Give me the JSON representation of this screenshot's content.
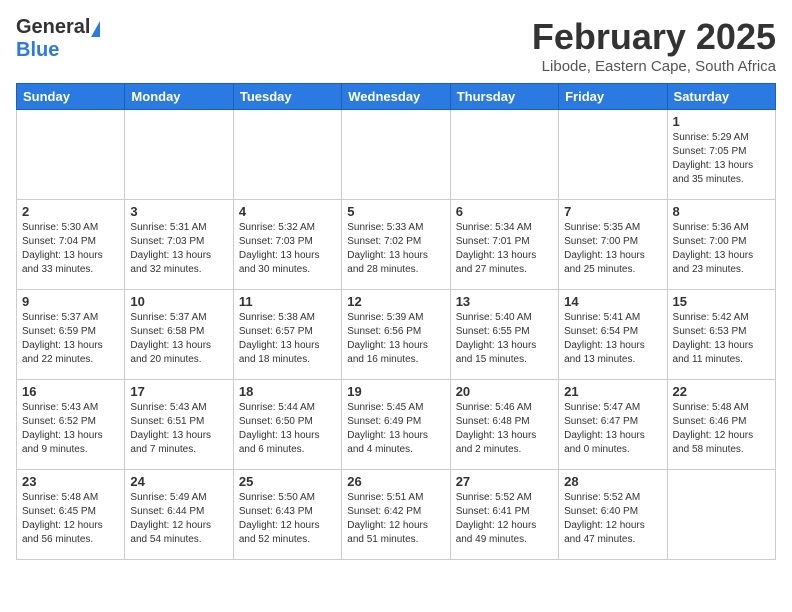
{
  "logo": {
    "general": "General",
    "blue": "Blue"
  },
  "title": "February 2025",
  "subtitle": "Libode, Eastern Cape, South Africa",
  "weekdays": [
    "Sunday",
    "Monday",
    "Tuesday",
    "Wednesday",
    "Thursday",
    "Friday",
    "Saturday"
  ],
  "weeks": [
    [
      {
        "day": "",
        "info": ""
      },
      {
        "day": "",
        "info": ""
      },
      {
        "day": "",
        "info": ""
      },
      {
        "day": "",
        "info": ""
      },
      {
        "day": "",
        "info": ""
      },
      {
        "day": "",
        "info": ""
      },
      {
        "day": "1",
        "info": "Sunrise: 5:29 AM\nSunset: 7:05 PM\nDaylight: 13 hours\nand 35 minutes."
      }
    ],
    [
      {
        "day": "2",
        "info": "Sunrise: 5:30 AM\nSunset: 7:04 PM\nDaylight: 13 hours\nand 33 minutes."
      },
      {
        "day": "3",
        "info": "Sunrise: 5:31 AM\nSunset: 7:03 PM\nDaylight: 13 hours\nand 32 minutes."
      },
      {
        "day": "4",
        "info": "Sunrise: 5:32 AM\nSunset: 7:03 PM\nDaylight: 13 hours\nand 30 minutes."
      },
      {
        "day": "5",
        "info": "Sunrise: 5:33 AM\nSunset: 7:02 PM\nDaylight: 13 hours\nand 28 minutes."
      },
      {
        "day": "6",
        "info": "Sunrise: 5:34 AM\nSunset: 7:01 PM\nDaylight: 13 hours\nand 27 minutes."
      },
      {
        "day": "7",
        "info": "Sunrise: 5:35 AM\nSunset: 7:00 PM\nDaylight: 13 hours\nand 25 minutes."
      },
      {
        "day": "8",
        "info": "Sunrise: 5:36 AM\nSunset: 7:00 PM\nDaylight: 13 hours\nand 23 minutes."
      }
    ],
    [
      {
        "day": "9",
        "info": "Sunrise: 5:37 AM\nSunset: 6:59 PM\nDaylight: 13 hours\nand 22 minutes."
      },
      {
        "day": "10",
        "info": "Sunrise: 5:37 AM\nSunset: 6:58 PM\nDaylight: 13 hours\nand 20 minutes."
      },
      {
        "day": "11",
        "info": "Sunrise: 5:38 AM\nSunset: 6:57 PM\nDaylight: 13 hours\nand 18 minutes."
      },
      {
        "day": "12",
        "info": "Sunrise: 5:39 AM\nSunset: 6:56 PM\nDaylight: 13 hours\nand 16 minutes."
      },
      {
        "day": "13",
        "info": "Sunrise: 5:40 AM\nSunset: 6:55 PM\nDaylight: 13 hours\nand 15 minutes."
      },
      {
        "day": "14",
        "info": "Sunrise: 5:41 AM\nSunset: 6:54 PM\nDaylight: 13 hours\nand 13 minutes."
      },
      {
        "day": "15",
        "info": "Sunrise: 5:42 AM\nSunset: 6:53 PM\nDaylight: 13 hours\nand 11 minutes."
      }
    ],
    [
      {
        "day": "16",
        "info": "Sunrise: 5:43 AM\nSunset: 6:52 PM\nDaylight: 13 hours\nand 9 minutes."
      },
      {
        "day": "17",
        "info": "Sunrise: 5:43 AM\nSunset: 6:51 PM\nDaylight: 13 hours\nand 7 minutes."
      },
      {
        "day": "18",
        "info": "Sunrise: 5:44 AM\nSunset: 6:50 PM\nDaylight: 13 hours\nand 6 minutes."
      },
      {
        "day": "19",
        "info": "Sunrise: 5:45 AM\nSunset: 6:49 PM\nDaylight: 13 hours\nand 4 minutes."
      },
      {
        "day": "20",
        "info": "Sunrise: 5:46 AM\nSunset: 6:48 PM\nDaylight: 13 hours\nand 2 minutes."
      },
      {
        "day": "21",
        "info": "Sunrise: 5:47 AM\nSunset: 6:47 PM\nDaylight: 13 hours\nand 0 minutes."
      },
      {
        "day": "22",
        "info": "Sunrise: 5:48 AM\nSunset: 6:46 PM\nDaylight: 12 hours\nand 58 minutes."
      }
    ],
    [
      {
        "day": "23",
        "info": "Sunrise: 5:48 AM\nSunset: 6:45 PM\nDaylight: 12 hours\nand 56 minutes."
      },
      {
        "day": "24",
        "info": "Sunrise: 5:49 AM\nSunset: 6:44 PM\nDaylight: 12 hours\nand 54 minutes."
      },
      {
        "day": "25",
        "info": "Sunrise: 5:50 AM\nSunset: 6:43 PM\nDaylight: 12 hours\nand 52 minutes."
      },
      {
        "day": "26",
        "info": "Sunrise: 5:51 AM\nSunset: 6:42 PM\nDaylight: 12 hours\nand 51 minutes."
      },
      {
        "day": "27",
        "info": "Sunrise: 5:52 AM\nSunset: 6:41 PM\nDaylight: 12 hours\nand 49 minutes."
      },
      {
        "day": "28",
        "info": "Sunrise: 5:52 AM\nSunset: 6:40 PM\nDaylight: 12 hours\nand 47 minutes."
      },
      {
        "day": "",
        "info": ""
      }
    ]
  ]
}
